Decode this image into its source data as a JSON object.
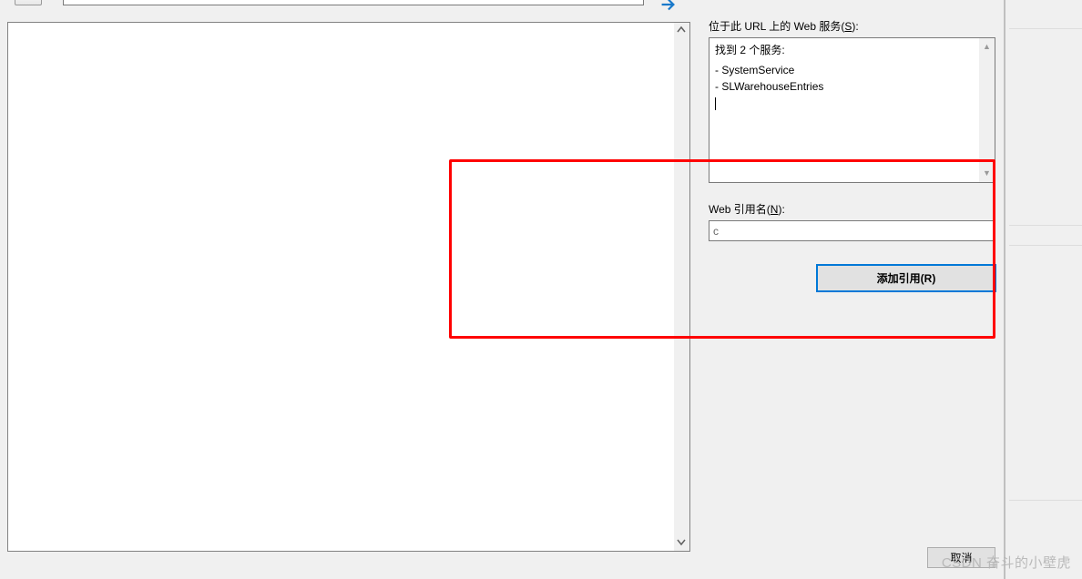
{
  "labels": {
    "services_at_url_prefix": "位于此 URL 上的 Web 服务(",
    "services_at_url_key": "S",
    "services_at_url_suffix": "):",
    "web_ref_name_prefix": "Web 引用名(",
    "web_ref_name_key": "N",
    "web_ref_name_suffix": "):"
  },
  "services_panel": {
    "found_text": "找到 2 个服务:",
    "items": [
      "- SystemService",
      "- SLWarehouseEntries"
    ]
  },
  "web_reference_input": {
    "value": "c",
    "placeholder": ""
  },
  "buttons": {
    "add_reference": "添加引用(R)",
    "cancel": "取消"
  },
  "watermark": "CSDN 奋斗的小壁虎"
}
